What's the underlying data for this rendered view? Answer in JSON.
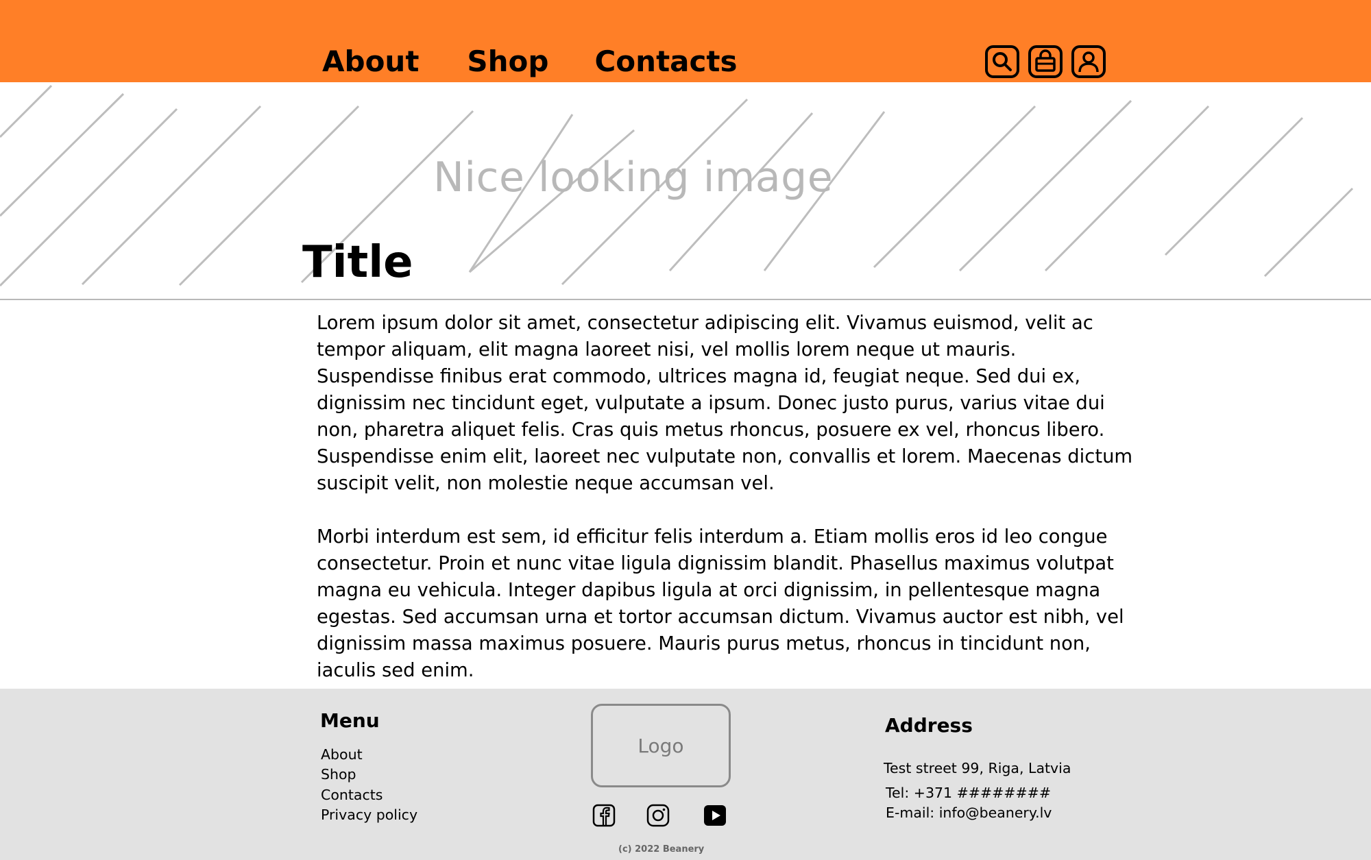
{
  "header": {
    "nav": [
      {
        "label": "About"
      },
      {
        "label": "Shop"
      },
      {
        "label": "Contacts"
      }
    ],
    "icons": [
      "search-icon",
      "bag-icon",
      "user-icon"
    ],
    "background_color": "#ff7f27"
  },
  "hero": {
    "caption": "Nice looking image",
    "title": "Title"
  },
  "content": {
    "paragraphs": [
      "Lorem ipsum dolor sit amet, consectetur adipiscing elit. Vivamus euismod, velit ac tempor aliquam, elit magna laoreet nisi, vel mollis lorem neque ut mauris. Suspendisse finibus erat commodo, ultrices magna id, feugiat neque. Sed dui ex, dignissim nec tincidunt eget, vulputate a ipsum. Donec justo purus, varius vitae dui non, pharetra aliquet felis. Cras quis metus rhoncus, posuere ex vel, rhoncus libero. Suspendisse enim elit, laoreet nec vulputate non, convallis et lorem. Maecenas dictum suscipit velit, non molestie neque accumsan vel.",
      "Morbi interdum est sem, id efficitur felis interdum a. Etiam mollis eros id leo congue consectetur. Proin et nunc vitae ligula dignissim blandit. Phasellus maximus volutpat magna eu vehicula. Integer dapibus ligula at orci dignissim, in pellentesque magna egestas. Sed accumsan urna et tortor accumsan dictum. Vivamus auctor est nibh, vel dignissim massa maximus posuere. Mauris purus metus, rhoncus in tincidunt non, iaculis sed enim."
    ]
  },
  "footer": {
    "menu_heading": "Menu",
    "menu_items": [
      {
        "label": "About"
      },
      {
        "label": "Shop"
      },
      {
        "label": "Contacts"
      },
      {
        "label": "Privacy policy"
      }
    ],
    "logo_text": "Logo",
    "social_icons": [
      "facebook-icon",
      "instagram-icon",
      "youtube-icon"
    ],
    "copyright": "(c) 2022  Beanery",
    "address_heading": "Address",
    "address_street": "Test street 99, Riga, Latvia",
    "address_tel": "Tel: +371 ########",
    "address_email": "E-mail: info@beanery.lv",
    "background_color": "#e2e2e2"
  }
}
